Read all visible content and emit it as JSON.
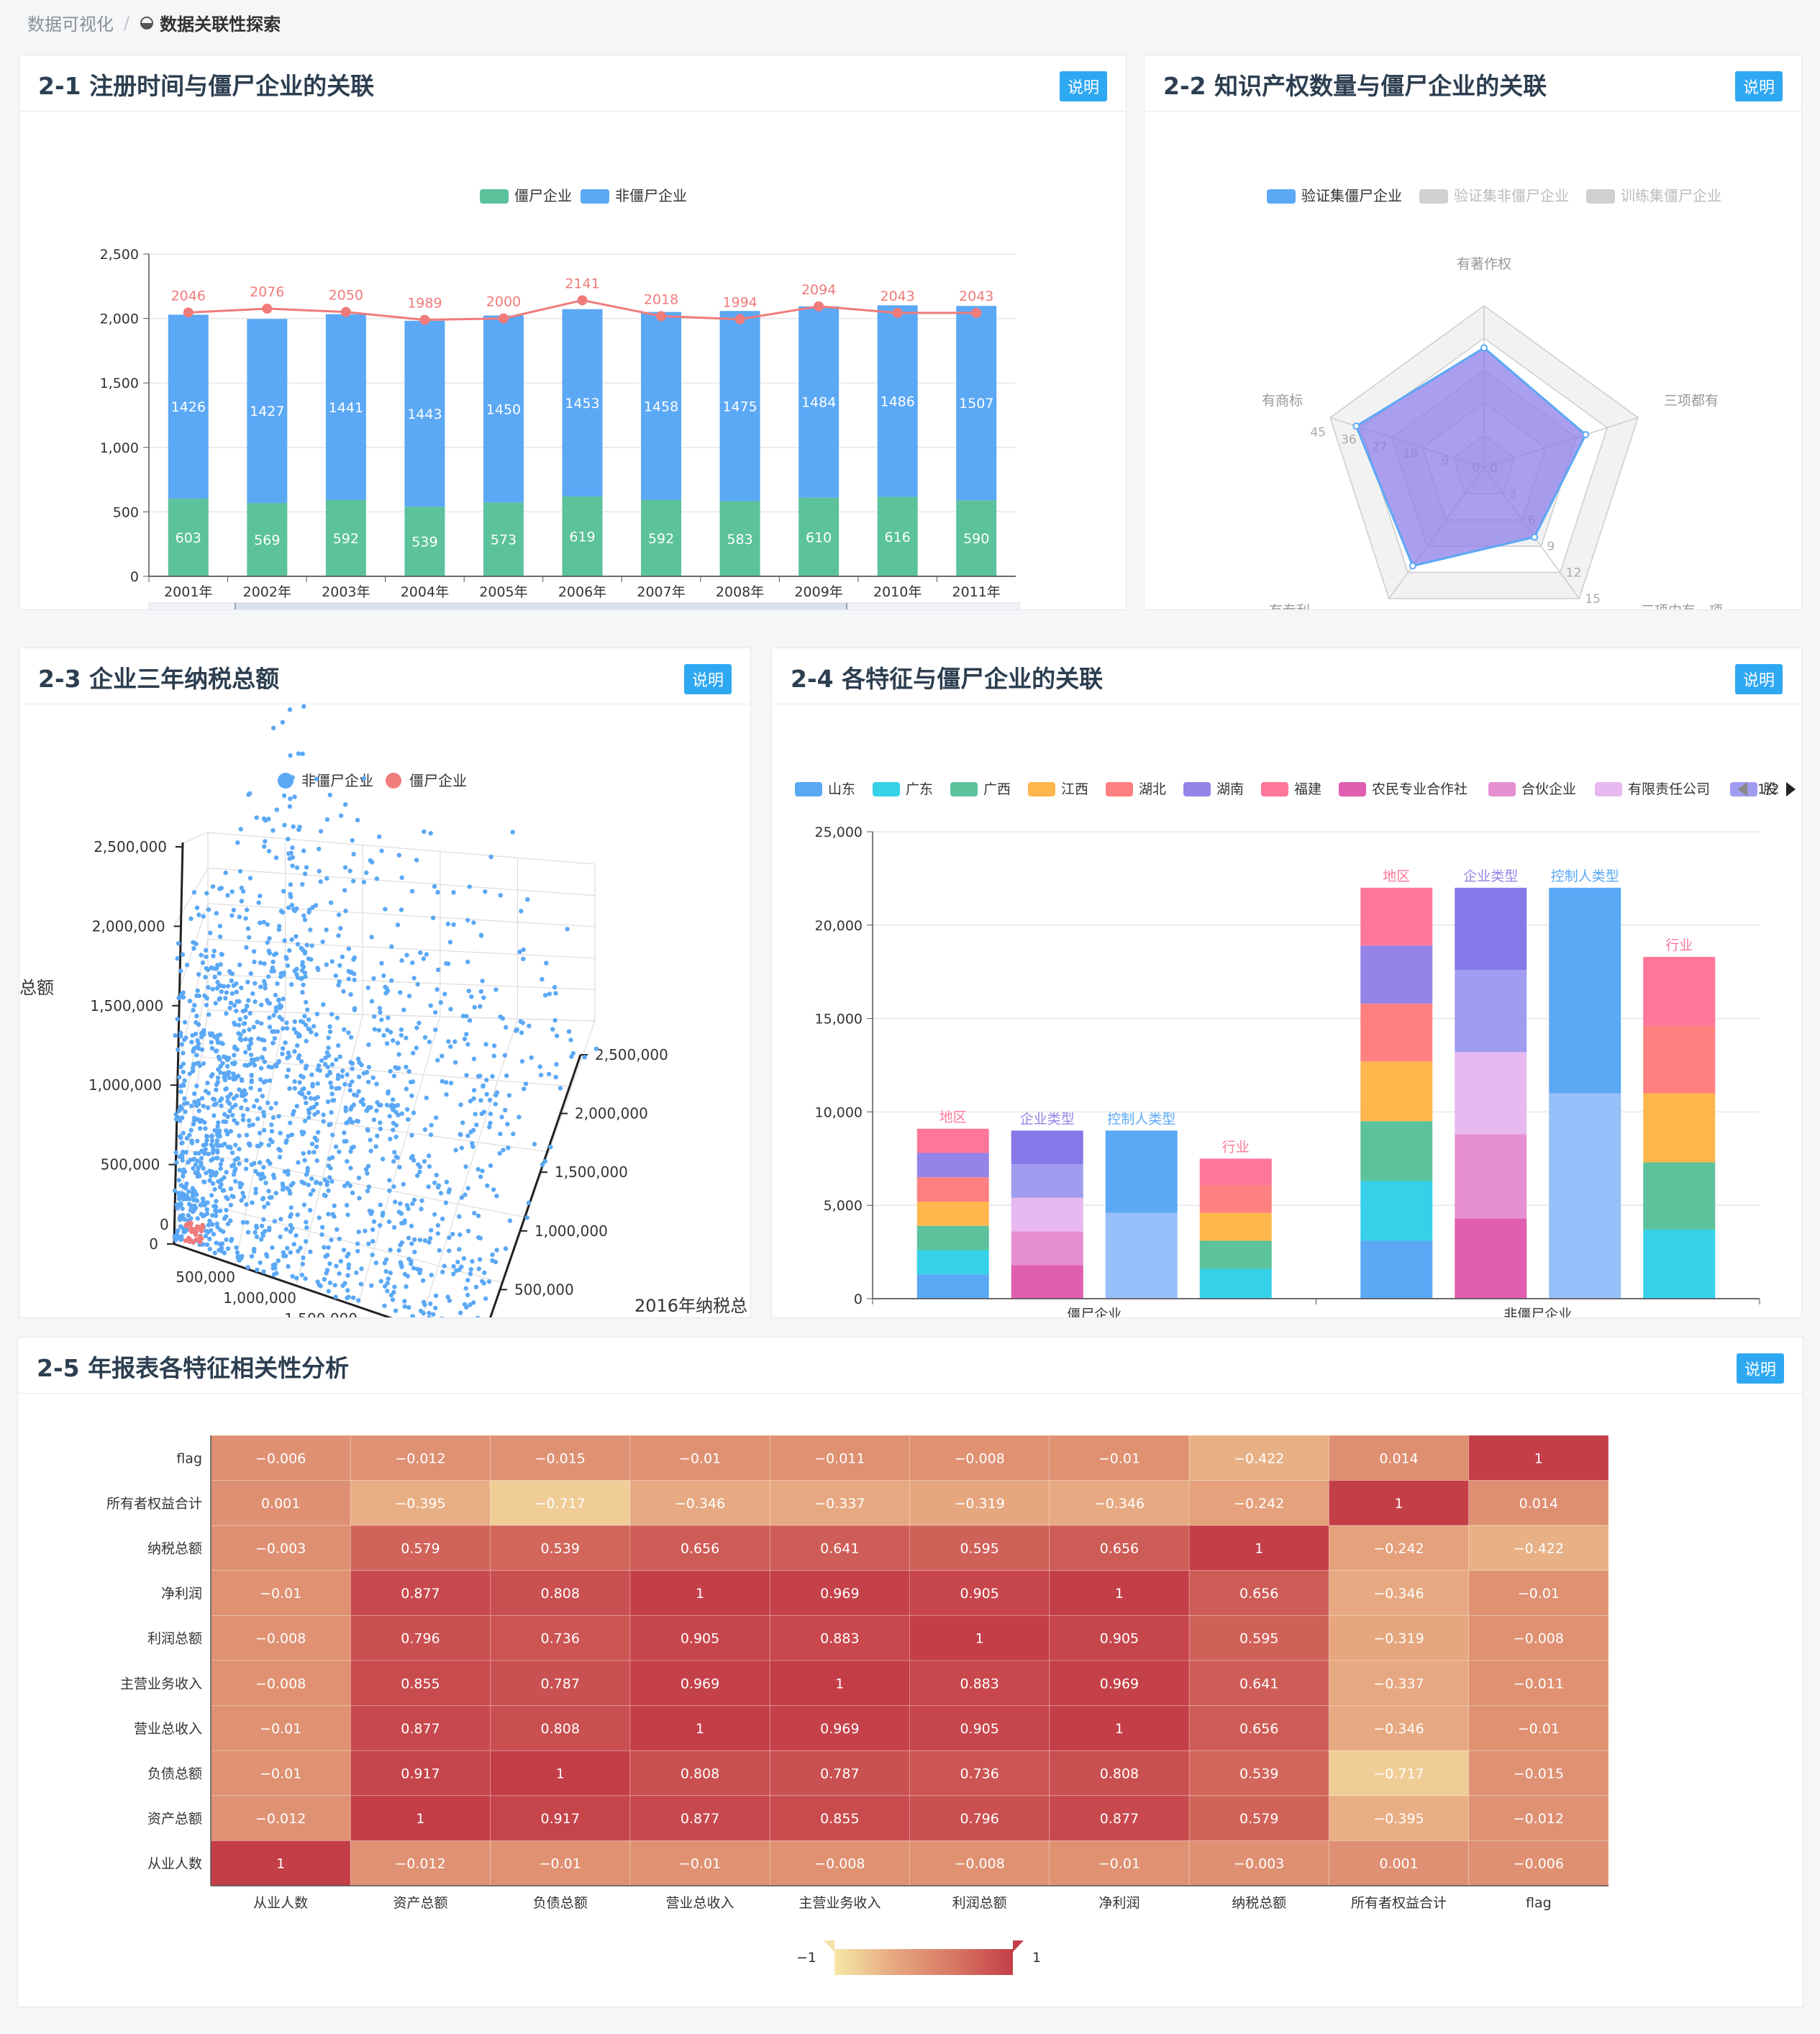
{
  "breadcrumb": {
    "root": "数据可视化",
    "current": "数据关联性探索"
  },
  "explain_label": "说明",
  "c1": {
    "title": "2-1 注册时间与僵尸企业的关联",
    "chart_data": {
      "type": "bar",
      "stacked": true,
      "ylim": [
        0,
        2500
      ],
      "yticks": [
        "0",
        "500",
        "1,000",
        "1,500",
        "2,000",
        "2,500"
      ],
      "legend": [
        {
          "name": "僵尸企业",
          "color": "#5cc29b"
        },
        {
          "name": "非僵尸企业",
          "color": "#5ba8f5"
        }
      ],
      "categories": [
        "2001年",
        "2002年",
        "2003年",
        "2004年",
        "2005年",
        "2006年",
        "2007年",
        "2008年",
        "2009年",
        "2010年",
        "2011年"
      ],
      "series": [
        {
          "name": "僵尸企业",
          "values": [
            603,
            569,
            592,
            539,
            573,
            619,
            592,
            583,
            610,
            616,
            590
          ]
        },
        {
          "name": "非僵尸企业",
          "values": [
            1426,
            1427,
            1441,
            1443,
            1450,
            1453,
            1458,
            1475,
            1484,
            1486,
            1507
          ]
        }
      ],
      "line": {
        "values": [
          2046,
          2076,
          2050,
          1989,
          2000,
          2141,
          2018,
          1994,
          2094,
          2043,
          2043
        ],
        "color": "#f07b7b"
      }
    }
  },
  "c2": {
    "title": "2-2 知识产权数量与僵尸企业的关联",
    "chart_data": {
      "type": "radar",
      "legend": [
        {
          "name": "验证集僵尸企业",
          "color": "#5ba8f5",
          "active": true
        },
        {
          "name": "验证集非僵尸企业",
          "color": "#d0d0d0",
          "active": false
        },
        {
          "name": "训练集僵尸企业",
          "color": "#d0d0d0",
          "active": false
        }
      ],
      "indicators": [
        "有著作权",
        "三项都有",
        "三项中有一项",
        "有专利",
        "有商标"
      ],
      "ticks_商标": [
        "0",
        "9",
        "18",
        "27",
        "36",
        "45"
      ],
      "ticks_一项": [
        "0",
        "3",
        "6",
        "9",
        "12",
        "15"
      ],
      "values": [
        0.74,
        0.66,
        0.53,
        0.75,
        0.83
      ]
    }
  },
  "c3": {
    "title": "2-3 企业三年纳税总额",
    "chart_data": {
      "type": "scatter",
      "legend": [
        {
          "name": "非僵尸企业",
          "color": "#5ba8f5"
        },
        {
          "name": "僵尸企业",
          "color": "#f07b7b"
        }
      ],
      "zticks": [
        "0",
        "500,000",
        "1,000,000",
        "1,500,000",
        "2,000,000",
        "2,500,000"
      ],
      "xticks": [
        "0",
        "500,000",
        "1,000,000",
        "1,500,000",
        "2,000,000",
        "2,500,000"
      ],
      "yticks": [
        "0",
        "500,000",
        "1,000,000",
        "1,500,000",
        "2,000,000",
        "2,500,000"
      ],
      "zlabel": "总额",
      "xlabel": "2015年纳税总额",
      "ylabel": "2016年纳税总"
    }
  },
  "c4": {
    "title": "2-4 各特征与僵尸企业的关联",
    "legend": [
      {
        "name": "山东",
        "color": "#5ba8f5"
      },
      {
        "name": "广东",
        "color": "#36d1e8"
      },
      {
        "name": "广西",
        "color": "#5cc29b"
      },
      {
        "name": "江西",
        "color": "#ffb64d"
      },
      {
        "name": "湖北",
        "color": "#ff8080"
      },
      {
        "name": "湖南",
        "color": "#9484e8"
      },
      {
        "name": "福建",
        "color": "#fe7799"
      },
      {
        "name": "农民专业合作社",
        "color": "#e05eb0"
      },
      {
        "name": "合伙企业",
        "color": "#e68fd0"
      },
      {
        "name": "有限责任公司",
        "color": "#e8b8f0"
      },
      {
        "name": "股",
        "color": "#a09cf0"
      }
    ],
    "pager": "1/2",
    "chart_data": {
      "type": "bar",
      "stacked": true,
      "ylim": [
        0,
        25000
      ],
      "yticks": [
        "0",
        "5,000",
        "10,000",
        "15,000",
        "20,000",
        "25,000"
      ],
      "groups": [
        "僵尸企业",
        "非僵尸企业"
      ],
      "bars": [
        {
          "label": "地区",
          "label_color": "#fe7799",
          "group": 0,
          "segs": [
            [
              1300,
              "#5ba8f5"
            ],
            [
              1300,
              "#36d1e8"
            ],
            [
              1300,
              "#5cc29b"
            ],
            [
              1300,
              "#ffb64d"
            ],
            [
              1300,
              "#ff8080"
            ],
            [
              1300,
              "#9484e8"
            ],
            [
              1300,
              "#fe7799"
            ]
          ]
        },
        {
          "label": "企业类型",
          "label_color": "#9484e8",
          "group": 0,
          "segs": [
            [
              1800,
              "#e05eb0"
            ],
            [
              1800,
              "#e68fd0"
            ],
            [
              1800,
              "#e8b8f0"
            ],
            [
              1800,
              "#a09cf0"
            ],
            [
              1800,
              "#8678e8"
            ]
          ]
        },
        {
          "label": "控制人类型",
          "label_color": "#5ba8f5",
          "group": 0,
          "segs": [
            [
              4600,
              "#97bff9"
            ],
            [
              4400,
              "#5ba8f5"
            ]
          ]
        },
        {
          "label": "行业",
          "label_color": "#fe7799",
          "group": 0,
          "segs": [
            [
              1600,
              "#36d1e8"
            ],
            [
              1500,
              "#5cc29b"
            ],
            [
              1500,
              "#ffb64d"
            ],
            [
              1500,
              "#ff8080"
            ],
            [
              1400,
              "#fe7799"
            ]
          ]
        },
        {
          "label": "地区",
          "label_color": "#fe7799",
          "group": 1,
          "segs": [
            [
              3100,
              "#5ba8f5"
            ],
            [
              3200,
              "#36d1e8"
            ],
            [
              3200,
              "#5cc29b"
            ],
            [
              3200,
              "#ffb64d"
            ],
            [
              3100,
              "#ff8080"
            ],
            [
              3100,
              "#9484e8"
            ],
            [
              3100,
              "#fe7799"
            ]
          ]
        },
        {
          "label": "企业类型",
          "label_color": "#9484e8",
          "group": 1,
          "segs": [
            [
              4300,
              "#e05eb0"
            ],
            [
              4500,
              "#e68fd0"
            ],
            [
              4400,
              "#e8b8f0"
            ],
            [
              4400,
              "#a09cf0"
            ],
            [
              4400,
              "#8678e8"
            ]
          ]
        },
        {
          "label": "控制人类型",
          "label_color": "#5ba8f5",
          "group": 1,
          "segs": [
            [
              11000,
              "#97bff9"
            ],
            [
              11000,
              "#5ba8f5"
            ]
          ]
        },
        {
          "label": "行业",
          "label_color": "#fe7799",
          "group": 1,
          "segs": [
            [
              3700,
              "#36d1e8"
            ],
            [
              3600,
              "#5cc29b"
            ],
            [
              3700,
              "#ffb64d"
            ],
            [
              3600,
              "#ff8080"
            ],
            [
              3700,
              "#fe7799"
            ]
          ]
        }
      ]
    }
  },
  "c5": {
    "title": "2-5 年报表各特征相关性分析",
    "chart_data": {
      "type": "heatmap",
      "range": [
        -1,
        1
      ],
      "min_label": "−1",
      "max_label": "1",
      "xcats": [
        "从业人数",
        "资产总额",
        "负债总额",
        "营业总收入",
        "主营业务收入",
        "利润总额",
        "净利润",
        "纳税总额",
        "所有者权益合计",
        "flag"
      ],
      "ycats": [
        "flag",
        "所有者权益合计",
        "纳税总额",
        "净利润",
        "利润总额",
        "主营业务收入",
        "营业总收入",
        "负债总额",
        "资产总额",
        "从业人数"
      ],
      "rows": [
        [
          "−0.006",
          "−0.012",
          "−0.015",
          "−0.01",
          "−0.011",
          "−0.008",
          "−0.01",
          "−0.422",
          "0.014",
          "1"
        ],
        [
          "0.001",
          "−0.395",
          "−0.717",
          "−0.346",
          "−0.337",
          "−0.319",
          "−0.346",
          "−0.242",
          "1",
          "0.014"
        ],
        [
          "−0.003",
          "0.579",
          "0.539",
          "0.656",
          "0.641",
          "0.595",
          "0.656",
          "1",
          "−0.242",
          "−0.422"
        ],
        [
          "−0.01",
          "0.877",
          "0.808",
          "1",
          "0.969",
          "0.905",
          "1",
          "0.656",
          "−0.346",
          "−0.01"
        ],
        [
          "−0.008",
          "0.796",
          "0.736",
          "0.905",
          "0.883",
          "1",
          "0.905",
          "0.595",
          "−0.319",
          "−0.008"
        ],
        [
          "−0.008",
          "0.855",
          "0.787",
          "0.969",
          "1",
          "0.883",
          "0.969",
          "0.641",
          "−0.337",
          "−0.011"
        ],
        [
          "−0.01",
          "0.877",
          "0.808",
          "1",
          "0.969",
          "0.905",
          "1",
          "0.656",
          "−0.346",
          "−0.01"
        ],
        [
          "−0.01",
          "0.917",
          "1",
          "0.808",
          "0.787",
          "0.736",
          "0.808",
          "0.539",
          "−0.717",
          "−0.015"
        ],
        [
          "−0.012",
          "1",
          "0.917",
          "0.877",
          "0.855",
          "0.796",
          "0.877",
          "0.579",
          "−0.395",
          "−0.012"
        ],
        [
          "1",
          "−0.012",
          "−0.01",
          "−0.01",
          "−0.008",
          "−0.008",
          "−0.01",
          "−0.003",
          "0.001",
          "−0.006"
        ]
      ]
    }
  }
}
